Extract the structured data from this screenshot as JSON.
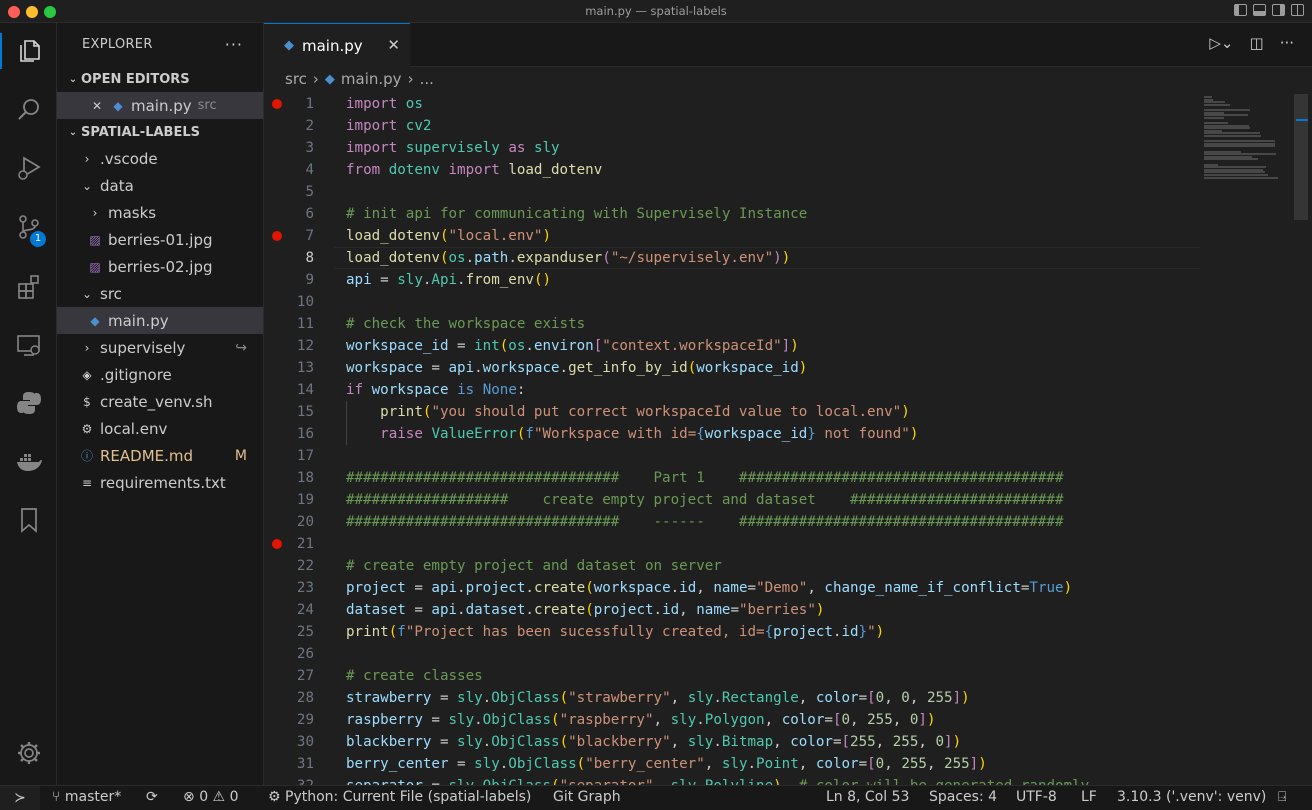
{
  "window": {
    "title": "main.py — spatial-labels"
  },
  "activity": {
    "scm_badge": "1"
  },
  "explorer": {
    "title": "EXPLORER",
    "more": "···",
    "open_editors": "OPEN EDITORS",
    "open_file": {
      "name": "main.py",
      "desc": "src"
    },
    "project": "SPATIAL-LABELS",
    "tree": [
      {
        "name": ".vscode",
        "type": "folder-closed",
        "indent": 1
      },
      {
        "name": "data",
        "type": "folder-open",
        "indent": 1
      },
      {
        "name": "masks",
        "type": "folder-closed",
        "indent": 2
      },
      {
        "name": "berries-01.jpg",
        "type": "image",
        "indent": 2
      },
      {
        "name": "berries-02.jpg",
        "type": "image",
        "indent": 2
      },
      {
        "name": "src",
        "type": "folder-open",
        "indent": 1
      },
      {
        "name": "main.py",
        "type": "python",
        "indent": 2,
        "selected": true
      },
      {
        "name": "supervisely",
        "type": "folder-closed",
        "indent": 1,
        "mark": "↪"
      },
      {
        "name": ".gitignore",
        "type": "gitignore",
        "indent": 1
      },
      {
        "name": "create_venv.sh",
        "type": "shell",
        "indent": 1
      },
      {
        "name": "local.env",
        "type": "env",
        "indent": 1
      },
      {
        "name": "README.md",
        "type": "info",
        "indent": 1,
        "mark": "M",
        "modified": true
      },
      {
        "name": "requirements.txt",
        "type": "text",
        "indent": 1
      }
    ]
  },
  "editor": {
    "tab": "main.py",
    "breadcrumb": [
      "src",
      "main.py",
      "..."
    ],
    "current_line": 8,
    "breakpoints": [
      1,
      7,
      21
    ],
    "lines": [
      [
        [
          "k",
          "import"
        ],
        [
          "p",
          " "
        ],
        [
          "m",
          "os"
        ]
      ],
      [
        [
          "k",
          "import"
        ],
        [
          "p",
          " "
        ],
        [
          "m",
          "cv2"
        ]
      ],
      [
        [
          "k",
          "import"
        ],
        [
          "p",
          " "
        ],
        [
          "m",
          "supervisely"
        ],
        [
          "p",
          " "
        ],
        [
          "k",
          "as"
        ],
        [
          "p",
          " "
        ],
        [
          "m",
          "sly"
        ]
      ],
      [
        [
          "k",
          "from"
        ],
        [
          "p",
          " "
        ],
        [
          "m",
          "dotenv"
        ],
        [
          "p",
          " "
        ],
        [
          "k",
          "import"
        ],
        [
          "p",
          " "
        ],
        [
          "f",
          "load_dotenv"
        ]
      ],
      [],
      [
        [
          "c",
          "# init api for communicating with Supervisely Instance"
        ]
      ],
      [
        [
          "f",
          "load_dotenv"
        ],
        [
          "br",
          "("
        ],
        [
          "s",
          "\"local.env\""
        ],
        [
          "br",
          ")"
        ]
      ],
      [
        [
          "f",
          "load_dotenv"
        ],
        [
          "br",
          "("
        ],
        [
          "m",
          "os"
        ],
        [
          "p",
          "."
        ],
        [
          "v",
          "path"
        ],
        [
          "p",
          "."
        ],
        [
          "f",
          "expanduser"
        ],
        [
          "k",
          "("
        ],
        [
          "s",
          "\"~/supervisely.env\""
        ],
        [
          "k",
          ")"
        ],
        [
          "br",
          ")"
        ]
      ],
      [
        [
          "v",
          "api"
        ],
        [
          "p",
          " = "
        ],
        [
          "m",
          "sly"
        ],
        [
          "p",
          "."
        ],
        [
          "m",
          "Api"
        ],
        [
          "p",
          "."
        ],
        [
          "f",
          "from_env"
        ],
        [
          "br",
          "()"
        ]
      ],
      [],
      [
        [
          "c",
          "# check the workspace exists"
        ]
      ],
      [
        [
          "v",
          "workspace_id"
        ],
        [
          "p",
          " = "
        ],
        [
          "m",
          "int"
        ],
        [
          "br",
          "("
        ],
        [
          "m",
          "os"
        ],
        [
          "p",
          "."
        ],
        [
          "v",
          "environ"
        ],
        [
          "k",
          "["
        ],
        [
          "s",
          "\"context.workspaceId\""
        ],
        [
          "k",
          "]"
        ],
        [
          "br",
          ")"
        ]
      ],
      [
        [
          "v",
          "workspace"
        ],
        [
          "p",
          " = "
        ],
        [
          "v",
          "api"
        ],
        [
          "p",
          "."
        ],
        [
          "v",
          "workspace"
        ],
        [
          "p",
          "."
        ],
        [
          "f",
          "get_info_by_id"
        ],
        [
          "br",
          "("
        ],
        [
          "v",
          "workspace_id"
        ],
        [
          "br",
          ")"
        ]
      ],
      [
        [
          "k",
          "if"
        ],
        [
          "p",
          " "
        ],
        [
          "v",
          "workspace"
        ],
        [
          "p",
          " "
        ],
        [
          "kb",
          "is"
        ],
        [
          "p",
          " "
        ],
        [
          "kb",
          "None"
        ],
        [
          "p",
          ":"
        ]
      ],
      [
        [
          "p",
          "    "
        ],
        [
          "f",
          "print"
        ],
        [
          "br",
          "("
        ],
        [
          "s",
          "\"you should put correct workspaceId value to local.env\""
        ],
        [
          "br",
          ")"
        ]
      ],
      [
        [
          "p",
          "    "
        ],
        [
          "k",
          "raise"
        ],
        [
          "p",
          " "
        ],
        [
          "m",
          "ValueError"
        ],
        [
          "br",
          "("
        ],
        [
          "kb",
          "f"
        ],
        [
          "s",
          "\"Workspace with id="
        ],
        [
          "kb",
          "{"
        ],
        [
          "v",
          "workspace_id"
        ],
        [
          "kb",
          "}"
        ],
        [
          "s",
          " not found\""
        ],
        [
          "br",
          ")"
        ]
      ],
      [],
      [
        [
          "c",
          "################################    Part 1    ######################################"
        ]
      ],
      [
        [
          "c",
          "###################    create empty project and dataset    #########################"
        ]
      ],
      [
        [
          "c",
          "################################    ------    ######################################"
        ]
      ],
      [],
      [
        [
          "c",
          "# create empty project and dataset on server"
        ]
      ],
      [
        [
          "v",
          "project"
        ],
        [
          "p",
          " = "
        ],
        [
          "v",
          "api"
        ],
        [
          "p",
          "."
        ],
        [
          "v",
          "project"
        ],
        [
          "p",
          "."
        ],
        [
          "f",
          "create"
        ],
        [
          "br",
          "("
        ],
        [
          "v",
          "workspace"
        ],
        [
          "p",
          "."
        ],
        [
          "v",
          "id"
        ],
        [
          "p",
          ", "
        ],
        [
          "v",
          "name"
        ],
        [
          "p",
          "="
        ],
        [
          "s",
          "\"Demo\""
        ],
        [
          "p",
          ", "
        ],
        [
          "v",
          "change_name_if_conflict"
        ],
        [
          "p",
          "="
        ],
        [
          "kb",
          "True"
        ],
        [
          "br",
          ")"
        ]
      ],
      [
        [
          "v",
          "dataset"
        ],
        [
          "p",
          " = "
        ],
        [
          "v",
          "api"
        ],
        [
          "p",
          "."
        ],
        [
          "v",
          "dataset"
        ],
        [
          "p",
          "."
        ],
        [
          "f",
          "create"
        ],
        [
          "br",
          "("
        ],
        [
          "v",
          "project"
        ],
        [
          "p",
          "."
        ],
        [
          "v",
          "id"
        ],
        [
          "p",
          ", "
        ],
        [
          "v",
          "name"
        ],
        [
          "p",
          "="
        ],
        [
          "s",
          "\"berries\""
        ],
        [
          "br",
          ")"
        ]
      ],
      [
        [
          "f",
          "print"
        ],
        [
          "br",
          "("
        ],
        [
          "kb",
          "f"
        ],
        [
          "s",
          "\"Project has been sucessfully created, id="
        ],
        [
          "kb",
          "{"
        ],
        [
          "v",
          "project"
        ],
        [
          "p",
          "."
        ],
        [
          "v",
          "id"
        ],
        [
          "kb",
          "}"
        ],
        [
          "s",
          "\""
        ],
        [
          "br",
          ")"
        ]
      ],
      [],
      [
        [
          "c",
          "# create classes"
        ]
      ],
      [
        [
          "v",
          "strawberry"
        ],
        [
          "p",
          " = "
        ],
        [
          "m",
          "sly"
        ],
        [
          "p",
          "."
        ],
        [
          "m",
          "ObjClass"
        ],
        [
          "br",
          "("
        ],
        [
          "s",
          "\"strawberry\""
        ],
        [
          "p",
          ", "
        ],
        [
          "m",
          "sly"
        ],
        [
          "p",
          "."
        ],
        [
          "m",
          "Rectangle"
        ],
        [
          "p",
          ", "
        ],
        [
          "v",
          "color"
        ],
        [
          "p",
          "="
        ],
        [
          "k",
          "["
        ],
        [
          "n",
          "0"
        ],
        [
          "p",
          ", "
        ],
        [
          "n",
          "0"
        ],
        [
          "p",
          ", "
        ],
        [
          "n",
          "255"
        ],
        [
          "k",
          "]"
        ],
        [
          "br",
          ")"
        ]
      ],
      [
        [
          "v",
          "raspberry"
        ],
        [
          "p",
          " = "
        ],
        [
          "m",
          "sly"
        ],
        [
          "p",
          "."
        ],
        [
          "m",
          "ObjClass"
        ],
        [
          "br",
          "("
        ],
        [
          "s",
          "\"raspberry\""
        ],
        [
          "p",
          ", "
        ],
        [
          "m",
          "sly"
        ],
        [
          "p",
          "."
        ],
        [
          "m",
          "Polygon"
        ],
        [
          "p",
          ", "
        ],
        [
          "v",
          "color"
        ],
        [
          "p",
          "="
        ],
        [
          "k",
          "["
        ],
        [
          "n",
          "0"
        ],
        [
          "p",
          ", "
        ],
        [
          "n",
          "255"
        ],
        [
          "p",
          ", "
        ],
        [
          "n",
          "0"
        ],
        [
          "k",
          "]"
        ],
        [
          "br",
          ")"
        ]
      ],
      [
        [
          "v",
          "blackberry"
        ],
        [
          "p",
          " = "
        ],
        [
          "m",
          "sly"
        ],
        [
          "p",
          "."
        ],
        [
          "m",
          "ObjClass"
        ],
        [
          "br",
          "("
        ],
        [
          "s",
          "\"blackberry\""
        ],
        [
          "p",
          ", "
        ],
        [
          "m",
          "sly"
        ],
        [
          "p",
          "."
        ],
        [
          "m",
          "Bitmap"
        ],
        [
          "p",
          ", "
        ],
        [
          "v",
          "color"
        ],
        [
          "p",
          "="
        ],
        [
          "k",
          "["
        ],
        [
          "n",
          "255"
        ],
        [
          "p",
          ", "
        ],
        [
          "n",
          "255"
        ],
        [
          "p",
          ", "
        ],
        [
          "n",
          "0"
        ],
        [
          "k",
          "]"
        ],
        [
          "br",
          ")"
        ]
      ],
      [
        [
          "v",
          "berry_center"
        ],
        [
          "p",
          " = "
        ],
        [
          "m",
          "sly"
        ],
        [
          "p",
          "."
        ],
        [
          "m",
          "ObjClass"
        ],
        [
          "br",
          "("
        ],
        [
          "s",
          "\"berry_center\""
        ],
        [
          "p",
          ", "
        ],
        [
          "m",
          "sly"
        ],
        [
          "p",
          "."
        ],
        [
          "m",
          "Point"
        ],
        [
          "p",
          ", "
        ],
        [
          "v",
          "color"
        ],
        [
          "p",
          "="
        ],
        [
          "k",
          "["
        ],
        [
          "n",
          "0"
        ],
        [
          "p",
          ", "
        ],
        [
          "n",
          "255"
        ],
        [
          "p",
          ", "
        ],
        [
          "n",
          "255"
        ],
        [
          "k",
          "]"
        ],
        [
          "br",
          ")"
        ]
      ],
      [
        [
          "v",
          "separator"
        ],
        [
          "p",
          " = "
        ],
        [
          "m",
          "sly"
        ],
        [
          "p",
          "."
        ],
        [
          "m",
          "ObjClass"
        ],
        [
          "br",
          "("
        ],
        [
          "s",
          "\"separator\""
        ],
        [
          "p",
          ", "
        ],
        [
          "m",
          "sly"
        ],
        [
          "p",
          "."
        ],
        [
          "m",
          "Polyline"
        ],
        [
          "br",
          ")"
        ],
        [
          "p",
          "  "
        ],
        [
          "c",
          "# color will be generated randomly"
        ]
      ]
    ]
  },
  "status": {
    "branch": "master*",
    "errors": "0",
    "warnings": "0",
    "debug": "Python: Current File (spatial-labels)",
    "git_graph": "Git Graph",
    "position": "Ln 8, Col 53",
    "spaces": "Spaces: 4",
    "encoding": "UTF-8",
    "eol": "LF",
    "interpreter": "3.10.3 ('.venv': venv)"
  },
  "colors": {
    "accent": "#0078d4",
    "breakpoint": "#e51400",
    "modified": "#e2c08d"
  }
}
